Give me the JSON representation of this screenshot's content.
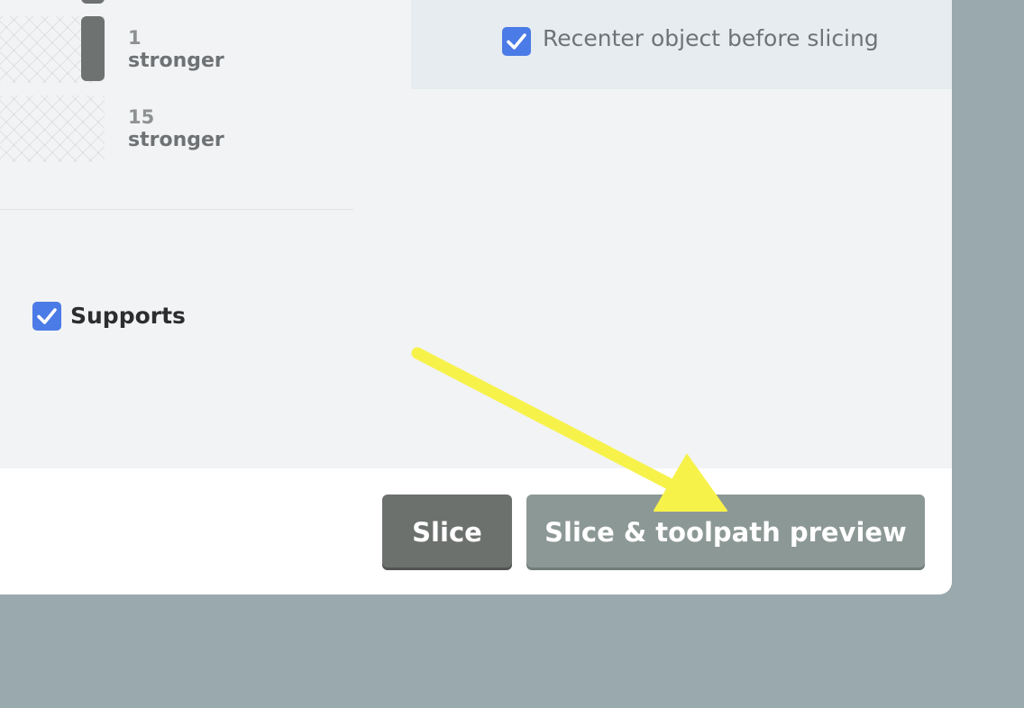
{
  "settings": {
    "recenter_label": "Recenter object before slicing",
    "recenter_checked": true,
    "supports_label": "Supports",
    "supports_checked": true
  },
  "strength_options": [
    {
      "count": "1",
      "label": "stronger"
    },
    {
      "count": "15",
      "label": "stronger"
    }
  ],
  "actions": {
    "slice_label": "Slice",
    "preview_label": "Slice & toolpath preview"
  },
  "annotation": {
    "arrow_color": "#f7f24a"
  },
  "colors": {
    "checkbox": "#4b7be6",
    "slice_button": "#6d716e",
    "preview_button": "#8c9895",
    "backdrop": "#9aa9ad"
  }
}
